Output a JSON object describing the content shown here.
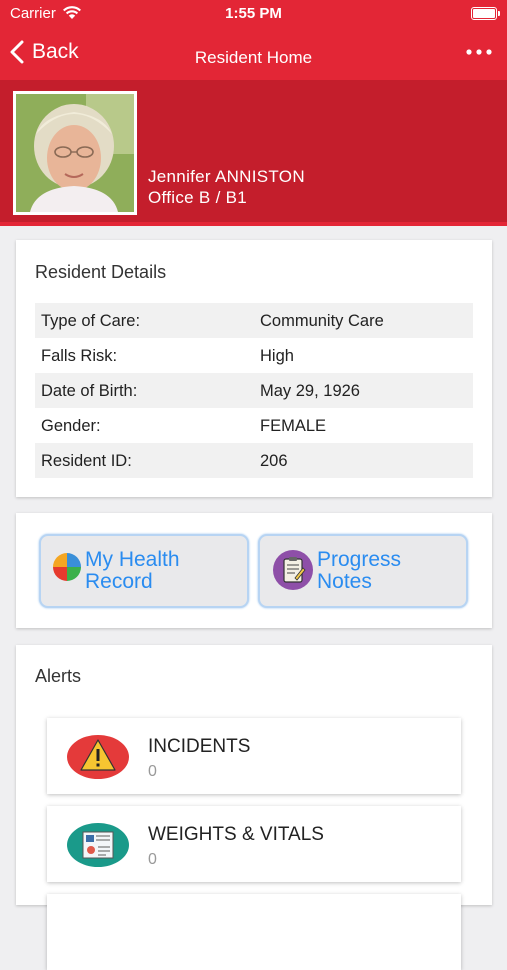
{
  "status_bar": {
    "carrier": "Carrier",
    "time": "1:55 PM",
    "battery_level": 1.0
  },
  "nav": {
    "back_label": "Back",
    "title": "Resident Home"
  },
  "resident": {
    "name": "Jennifer ANNISTON",
    "office": "Office B / B1"
  },
  "details": {
    "title": "Resident Details",
    "rows": [
      {
        "key": "Type of Care:",
        "value": "Community Care"
      },
      {
        "key": "Falls Risk:",
        "value": "High"
      },
      {
        "key": "Date of Birth:",
        "value": "May 29, 1926"
      },
      {
        "key": "Gender:",
        "value": "FEMALE"
      },
      {
        "key": "Resident ID:",
        "value": "206"
      }
    ]
  },
  "actions": {
    "health_record": {
      "line1": "My Health",
      "line2": "Record"
    },
    "progress_notes": {
      "line1": "Progress",
      "line2": "Notes"
    }
  },
  "alerts": {
    "title": "Alerts",
    "items": [
      {
        "name": "INCIDENTS",
        "count": "0"
      },
      {
        "name": "WEIGHTS & VITALS",
        "count": "0"
      }
    ]
  },
  "colors": {
    "brand_red": "#e32636",
    "header_red": "#c41e2c",
    "link_blue": "#2a8cf0"
  }
}
